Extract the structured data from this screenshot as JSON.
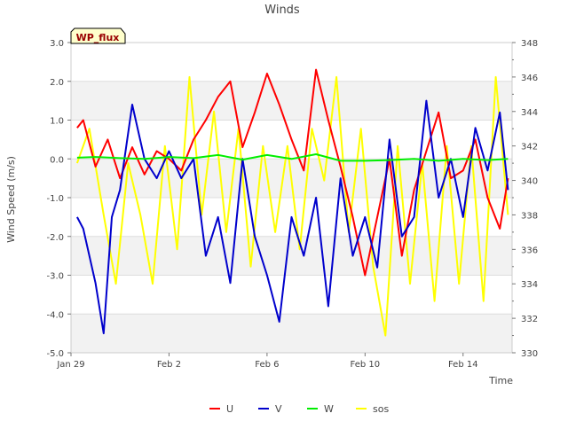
{
  "chart_data": {
    "type": "line",
    "title": "Winds",
    "badge": "WP_flux",
    "xlabel": "Time",
    "ylabel": "Wind Speed (m/s)",
    "ylim": [
      -5.0,
      3.0
    ],
    "y2lim": [
      330,
      348
    ],
    "xlim": [
      "2023-01-29",
      "2023-02-16"
    ],
    "yticks": [
      "-5.0",
      "-4.0",
      "-3.0",
      "-2.0",
      "-1.0",
      "0.0",
      "1.0",
      "2.0",
      "3.0"
    ],
    "y2ticks": [
      "330",
      "332",
      "334",
      "336",
      "338",
      "340",
      "342",
      "344",
      "346",
      "348"
    ],
    "xticks": [
      {
        "date": "2023-01-29",
        "label": "Jan 29"
      },
      {
        "date": "2023-02-02",
        "label": "Feb 2"
      },
      {
        "date": "2023-02-06",
        "label": "Feb 6"
      },
      {
        "date": "2023-02-10",
        "label": "Feb 10"
      },
      {
        "date": "2023-02-14",
        "label": "Feb 14"
      }
    ],
    "grid": true,
    "legend_position": "bottom",
    "series": [
      {
        "name": "U",
        "color": "#ff0000",
        "axis": "left",
        "x": [
          "2023-01-29 06:00",
          "2023-01-29 12:00",
          "2023-01-30 00:00",
          "2023-01-30 12:00",
          "2023-01-31 00:00",
          "2023-01-31 12:00",
          "2023-02-01 00:00",
          "2023-02-01 12:00",
          "2023-02-02 00:00",
          "2023-02-02 12:00",
          "2023-02-03 00:00",
          "2023-02-03 12:00",
          "2023-02-04 00:00",
          "2023-02-04 12:00",
          "2023-02-05 00:00",
          "2023-02-05 12:00",
          "2023-02-06 00:00",
          "2023-02-06 12:00",
          "2023-02-07 00:00",
          "2023-02-07 12:00",
          "2023-02-08 00:00",
          "2023-02-08 12:00",
          "2023-02-09 00:00",
          "2023-02-09 12:00",
          "2023-02-10 00:00",
          "2023-02-10 12:00",
          "2023-02-11 00:00",
          "2023-02-11 12:00",
          "2023-02-12 00:00",
          "2023-02-12 12:00",
          "2023-02-13 00:00",
          "2023-02-13 12:00",
          "2023-02-14 00:00",
          "2023-02-14 12:00",
          "2023-02-15 00:00",
          "2023-02-15 12:00",
          "2023-02-15 20:00"
        ],
        "y": [
          0.8,
          1.0,
          -0.2,
          0.5,
          -0.5,
          0.3,
          -0.4,
          0.2,
          0.0,
          -0.3,
          0.5,
          1.0,
          1.6,
          2.0,
          0.3,
          1.2,
          2.2,
          1.4,
          0.5,
          -0.3,
          2.3,
          1.0,
          -0.2,
          -1.5,
          -3.0,
          -1.5,
          0.0,
          -2.5,
          -0.8,
          0.2,
          1.2,
          -0.5,
          -0.3,
          0.5,
          -1.0,
          -1.8,
          -0.5
        ]
      },
      {
        "name": "V",
        "color": "#0000cc",
        "axis": "left",
        "x": [
          "2023-01-29 06:00",
          "2023-01-29 12:00",
          "2023-01-30 00:00",
          "2023-01-30 08:00",
          "2023-01-30 16:00",
          "2023-01-31 00:00",
          "2023-01-31 12:00",
          "2023-02-01 00:00",
          "2023-02-01 12:00",
          "2023-02-02 00:00",
          "2023-02-02 12:00",
          "2023-02-03 00:00",
          "2023-02-03 12:00",
          "2023-02-04 00:00",
          "2023-02-04 12:00",
          "2023-02-05 00:00",
          "2023-02-05 12:00",
          "2023-02-06 00:00",
          "2023-02-06 12:00",
          "2023-02-07 00:00",
          "2023-02-07 12:00",
          "2023-02-08 00:00",
          "2023-02-08 12:00",
          "2023-02-09 00:00",
          "2023-02-09 12:00",
          "2023-02-10 00:00",
          "2023-02-10 12:00",
          "2023-02-11 00:00",
          "2023-02-11 12:00",
          "2023-02-12 00:00",
          "2023-02-12 12:00",
          "2023-02-13 00:00",
          "2023-02-13 12:00",
          "2023-02-14 00:00",
          "2023-02-14 12:00",
          "2023-02-15 00:00",
          "2023-02-15 12:00",
          "2023-02-15 20:00"
        ],
        "y": [
          -1.5,
          -1.8,
          -3.2,
          -4.5,
          -1.5,
          -0.8,
          1.4,
          0.0,
          -0.5,
          0.2,
          -0.5,
          0.0,
          -2.5,
          -1.5,
          -3.2,
          0.0,
          -2.0,
          -3.0,
          -4.2,
          -1.5,
          -2.5,
          -1.0,
          -3.8,
          -0.5,
          -2.5,
          -1.5,
          -2.8,
          0.5,
          -2.0,
          -1.5,
          1.5,
          -1.0,
          0.0,
          -1.5,
          0.8,
          -0.3,
          1.2,
          -0.8
        ]
      },
      {
        "name": "W",
        "color": "#00ee00",
        "axis": "left",
        "x": [
          "2023-01-29 06:00",
          "2023-01-30 00:00",
          "2023-01-31 00:00",
          "2023-02-01 00:00",
          "2023-02-02 00:00",
          "2023-02-03 00:00",
          "2023-02-04 00:00",
          "2023-02-05 00:00",
          "2023-02-06 00:00",
          "2023-02-07 00:00",
          "2023-02-08 00:00",
          "2023-02-09 00:00",
          "2023-02-10 00:00",
          "2023-02-11 00:00",
          "2023-02-12 00:00",
          "2023-02-13 00:00",
          "2023-02-14 00:00",
          "2023-02-15 00:00",
          "2023-02-15 20:00"
        ],
        "y": [
          0.03,
          0.05,
          0.02,
          0.0,
          0.05,
          0.02,
          0.1,
          -0.02,
          0.1,
          0.0,
          0.12,
          -0.05,
          -0.05,
          -0.03,
          0.0,
          -0.05,
          0.0,
          -0.03,
          0.0
        ]
      },
      {
        "name": "sos",
        "color": "#ffff00",
        "axis": "right",
        "x": [
          "2023-01-29 06:00",
          "2023-01-29 18:00",
          "2023-01-30 08:00",
          "2023-01-30 20:00",
          "2023-01-31 08:00",
          "2023-01-31 20:00",
          "2023-02-01 08:00",
          "2023-02-01 20:00",
          "2023-02-02 08:00",
          "2023-02-02 20:00",
          "2023-02-03 08:00",
          "2023-02-03 20:00",
          "2023-02-04 08:00",
          "2023-02-04 20:00",
          "2023-02-05 08:00",
          "2023-02-05 20:00",
          "2023-02-06 08:00",
          "2023-02-06 20:00",
          "2023-02-07 08:00",
          "2023-02-07 20:00",
          "2023-02-08 08:00",
          "2023-02-08 20:00",
          "2023-02-09 08:00",
          "2023-02-09 20:00",
          "2023-02-10 08:00",
          "2023-02-10 20:00",
          "2023-02-11 08:00",
          "2023-02-11 20:00",
          "2023-02-12 08:00",
          "2023-02-12 20:00",
          "2023-02-13 08:00",
          "2023-02-13 20:00",
          "2023-02-14 08:00",
          "2023-02-14 20:00",
          "2023-02-15 08:00",
          "2023-02-15 20:00"
        ],
        "y": [
          341,
          343,
          338,
          334,
          341,
          338,
          334,
          342,
          336,
          346,
          338,
          344,
          337,
          343,
          335,
          342,
          337,
          342,
          336,
          343,
          340,
          346,
          337,
          343,
          335,
          331,
          342,
          334,
          341,
          333,
          342,
          334,
          342,
          333,
          346,
          338
        ]
      }
    ]
  }
}
